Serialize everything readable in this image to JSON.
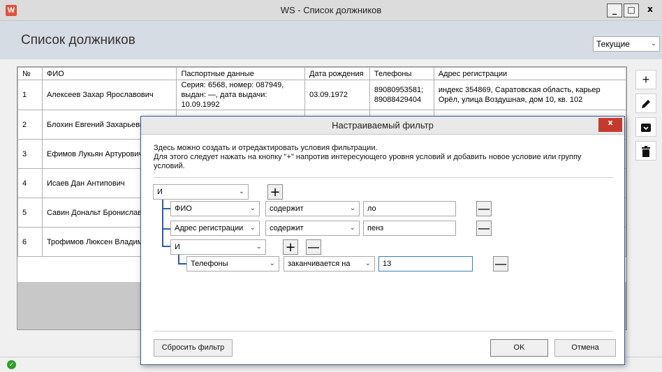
{
  "window": {
    "app_icon": "app-logo-icon",
    "title": "WS - Список должников",
    "minimize_glyph": "_",
    "maximize_glyph": "□",
    "close_glyph": "x"
  },
  "header": {
    "title": "Список должников",
    "status_select": "Текущие"
  },
  "table": {
    "headers": [
      "№",
      "ФИО",
      "Паспортные данные",
      "Дата рождения",
      "Телефоны",
      "Адрес регистрации"
    ],
    "rows": [
      {
        "num": "1",
        "name": "Алексеев Захар Ярославович",
        "passport": "Серия: 6568, номер: 087949, выдан: —, дата выдачи: 10.09.1992",
        "birth": "03.09.1972",
        "phones": "89080953581; 89088429404",
        "address": "индекс 354869, Саратовская область, карьер Орёл, улица Воздушная, дом 10, кв. 102"
      },
      {
        "num": "2",
        "name": "Блохин Евгений Захарьеви",
        "passport": "",
        "birth": "",
        "phones": "",
        "address": ""
      },
      {
        "num": "3",
        "name": "Ефимов Лукьян Артурович",
        "passport": "",
        "birth": "",
        "phones": "",
        "address": ""
      },
      {
        "num": "4",
        "name": "Исаев Дан Антипович",
        "passport": "",
        "birth": "",
        "phones": "",
        "address": ""
      },
      {
        "num": "5",
        "name": "Савин Дональт Брониславо",
        "passport": "",
        "birth": "",
        "phones": "",
        "address": ""
      },
      {
        "num": "6",
        "name": "Трофимов Люксен Владим",
        "passport": "",
        "birth": "",
        "phones": "",
        "address": ""
      }
    ]
  },
  "side_toolbar": {
    "add": "+",
    "edit_icon": "pencil-icon",
    "archive_icon": "archive-icon",
    "delete_icon": "trash-icon"
  },
  "dialog": {
    "title": "Настраиваемый фильтр",
    "close_glyph": "x",
    "description_line1": "Здесь можно создать и отредактировать условия фильтрации.",
    "description_line2": "Для этого следует нажать на кнопку \"+\" напротив интересующего уровня условий и добавить новое условие или группу условий.",
    "root_group": "И",
    "conditions": [
      {
        "field": "ФИО",
        "operator": "содержит",
        "value": "ло"
      },
      {
        "field": "Адрес регистрации",
        "operator": "содержит",
        "value": "пенз"
      }
    ],
    "sub_group": "И",
    "sub_conditions": [
      {
        "field": "Телефоны",
        "operator": "заканчивается на",
        "value": "13"
      }
    ],
    "plus": "+",
    "minus": "—",
    "reset_button": "Сбросить фильтр",
    "ok_button": "OK",
    "cancel_button": "Отмена"
  },
  "status": {
    "icon": "check-circle-icon"
  },
  "colors": {
    "accent": "#2b5ea7",
    "close_red": "#c43b2d",
    "header_bg": "#d6dce4"
  }
}
